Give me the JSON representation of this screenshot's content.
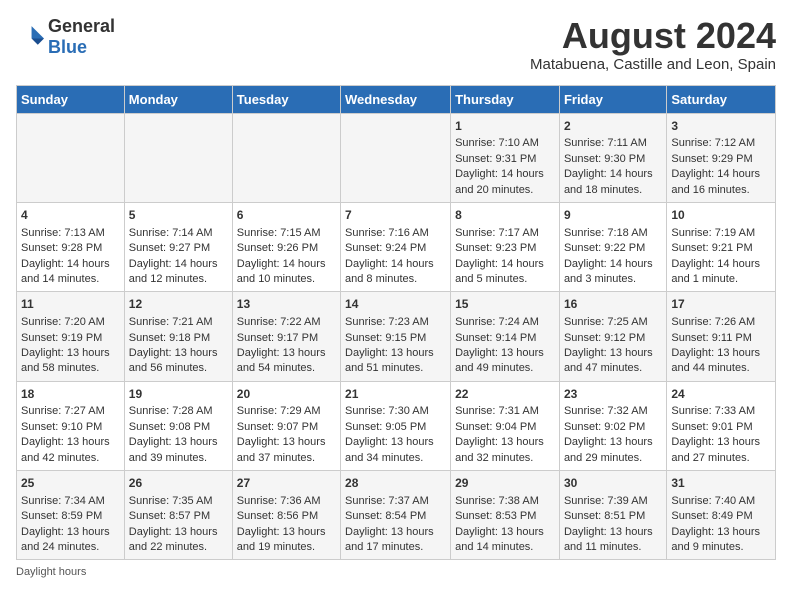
{
  "logo": {
    "general": "General",
    "blue": "Blue"
  },
  "title": "August 2024",
  "subtitle": "Matabuena, Castille and Leon, Spain",
  "days_of_week": [
    "Sunday",
    "Monday",
    "Tuesday",
    "Wednesday",
    "Thursday",
    "Friday",
    "Saturday"
  ],
  "weeks": [
    [
      {
        "day": "",
        "content": ""
      },
      {
        "day": "",
        "content": ""
      },
      {
        "day": "",
        "content": ""
      },
      {
        "day": "",
        "content": ""
      },
      {
        "day": "1",
        "content": "Sunrise: 7:10 AM\nSunset: 9:31 PM\nDaylight: 14 hours and 20 minutes."
      },
      {
        "day": "2",
        "content": "Sunrise: 7:11 AM\nSunset: 9:30 PM\nDaylight: 14 hours and 18 minutes."
      },
      {
        "day": "3",
        "content": "Sunrise: 7:12 AM\nSunset: 9:29 PM\nDaylight: 14 hours and 16 minutes."
      }
    ],
    [
      {
        "day": "4",
        "content": "Sunrise: 7:13 AM\nSunset: 9:28 PM\nDaylight: 14 hours and 14 minutes."
      },
      {
        "day": "5",
        "content": "Sunrise: 7:14 AM\nSunset: 9:27 PM\nDaylight: 14 hours and 12 minutes."
      },
      {
        "day": "6",
        "content": "Sunrise: 7:15 AM\nSunset: 9:26 PM\nDaylight: 14 hours and 10 minutes."
      },
      {
        "day": "7",
        "content": "Sunrise: 7:16 AM\nSunset: 9:24 PM\nDaylight: 14 hours and 8 minutes."
      },
      {
        "day": "8",
        "content": "Sunrise: 7:17 AM\nSunset: 9:23 PM\nDaylight: 14 hours and 5 minutes."
      },
      {
        "day": "9",
        "content": "Sunrise: 7:18 AM\nSunset: 9:22 PM\nDaylight: 14 hours and 3 minutes."
      },
      {
        "day": "10",
        "content": "Sunrise: 7:19 AM\nSunset: 9:21 PM\nDaylight: 14 hours and 1 minute."
      }
    ],
    [
      {
        "day": "11",
        "content": "Sunrise: 7:20 AM\nSunset: 9:19 PM\nDaylight: 13 hours and 58 minutes."
      },
      {
        "day": "12",
        "content": "Sunrise: 7:21 AM\nSunset: 9:18 PM\nDaylight: 13 hours and 56 minutes."
      },
      {
        "day": "13",
        "content": "Sunrise: 7:22 AM\nSunset: 9:17 PM\nDaylight: 13 hours and 54 minutes."
      },
      {
        "day": "14",
        "content": "Sunrise: 7:23 AM\nSunset: 9:15 PM\nDaylight: 13 hours and 51 minutes."
      },
      {
        "day": "15",
        "content": "Sunrise: 7:24 AM\nSunset: 9:14 PM\nDaylight: 13 hours and 49 minutes."
      },
      {
        "day": "16",
        "content": "Sunrise: 7:25 AM\nSunset: 9:12 PM\nDaylight: 13 hours and 47 minutes."
      },
      {
        "day": "17",
        "content": "Sunrise: 7:26 AM\nSunset: 9:11 PM\nDaylight: 13 hours and 44 minutes."
      }
    ],
    [
      {
        "day": "18",
        "content": "Sunrise: 7:27 AM\nSunset: 9:10 PM\nDaylight: 13 hours and 42 minutes."
      },
      {
        "day": "19",
        "content": "Sunrise: 7:28 AM\nSunset: 9:08 PM\nDaylight: 13 hours and 39 minutes."
      },
      {
        "day": "20",
        "content": "Sunrise: 7:29 AM\nSunset: 9:07 PM\nDaylight: 13 hours and 37 minutes."
      },
      {
        "day": "21",
        "content": "Sunrise: 7:30 AM\nSunset: 9:05 PM\nDaylight: 13 hours and 34 minutes."
      },
      {
        "day": "22",
        "content": "Sunrise: 7:31 AM\nSunset: 9:04 PM\nDaylight: 13 hours and 32 minutes."
      },
      {
        "day": "23",
        "content": "Sunrise: 7:32 AM\nSunset: 9:02 PM\nDaylight: 13 hours and 29 minutes."
      },
      {
        "day": "24",
        "content": "Sunrise: 7:33 AM\nSunset: 9:01 PM\nDaylight: 13 hours and 27 minutes."
      }
    ],
    [
      {
        "day": "25",
        "content": "Sunrise: 7:34 AM\nSunset: 8:59 PM\nDaylight: 13 hours and 24 minutes."
      },
      {
        "day": "26",
        "content": "Sunrise: 7:35 AM\nSunset: 8:57 PM\nDaylight: 13 hours and 22 minutes."
      },
      {
        "day": "27",
        "content": "Sunrise: 7:36 AM\nSunset: 8:56 PM\nDaylight: 13 hours and 19 minutes."
      },
      {
        "day": "28",
        "content": "Sunrise: 7:37 AM\nSunset: 8:54 PM\nDaylight: 13 hours and 17 minutes."
      },
      {
        "day": "29",
        "content": "Sunrise: 7:38 AM\nSunset: 8:53 PM\nDaylight: 13 hours and 14 minutes."
      },
      {
        "day": "30",
        "content": "Sunrise: 7:39 AM\nSunset: 8:51 PM\nDaylight: 13 hours and 11 minutes."
      },
      {
        "day": "31",
        "content": "Sunrise: 7:40 AM\nSunset: 8:49 PM\nDaylight: 13 hours and 9 minutes."
      }
    ]
  ],
  "footer": "Daylight hours"
}
